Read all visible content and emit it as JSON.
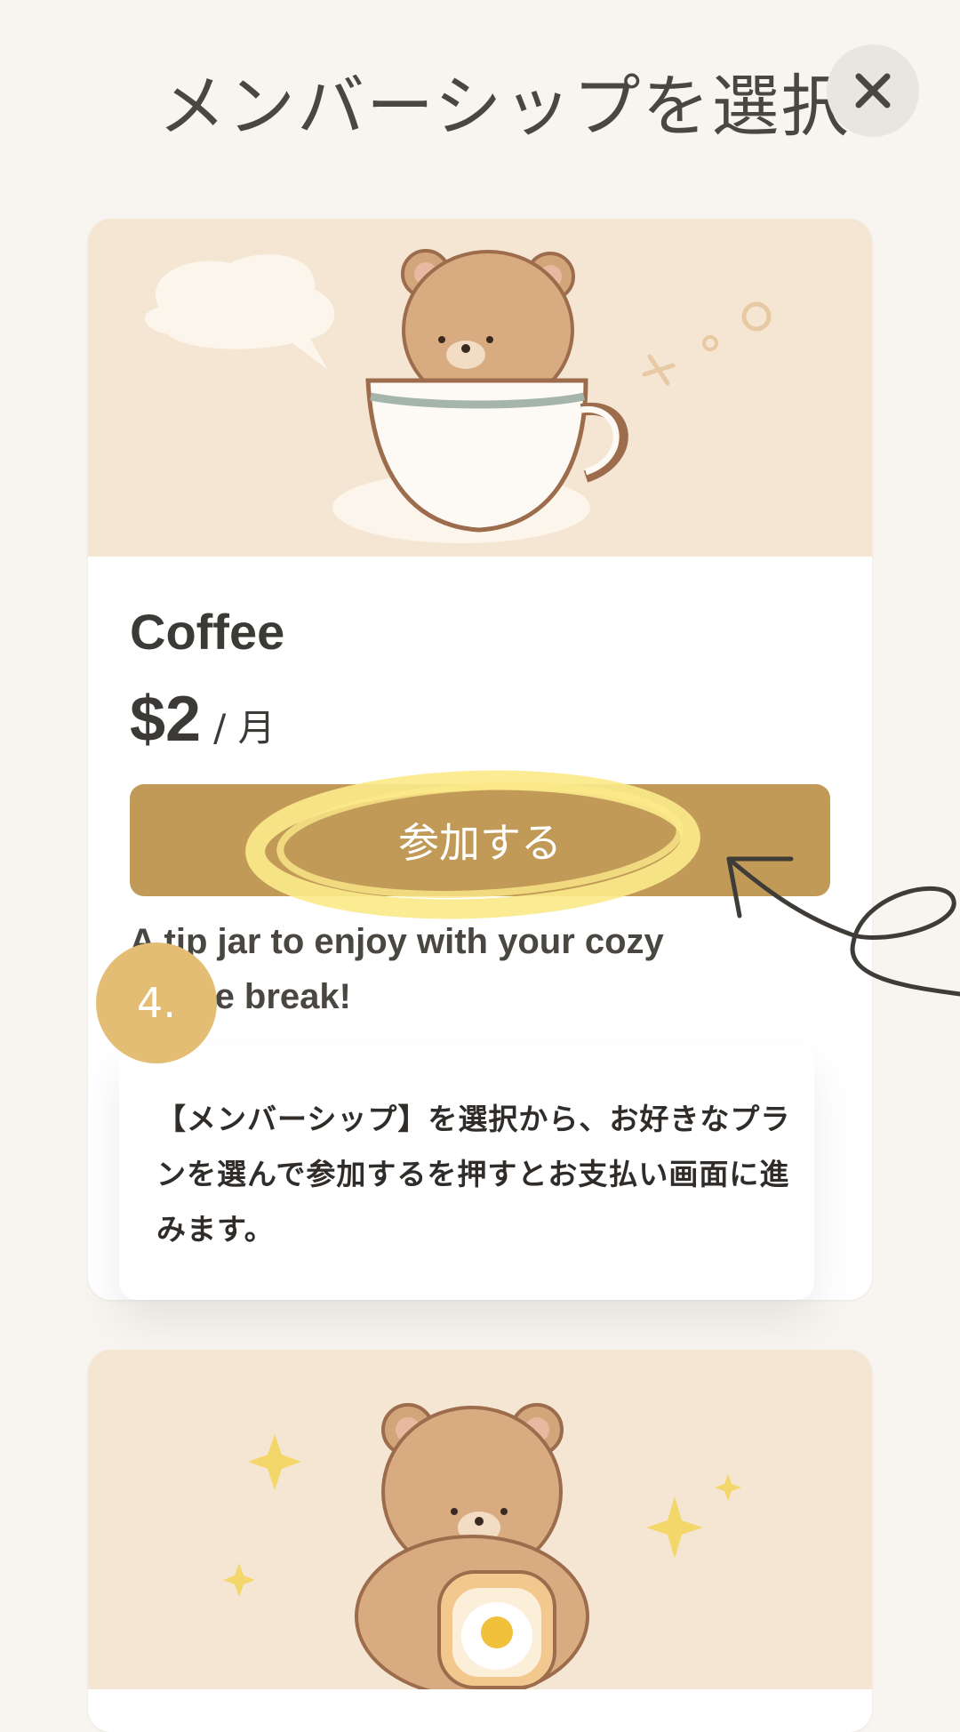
{
  "header": {
    "title": "メンバーシップを選択",
    "close_icon": "close-icon"
  },
  "tiers": [
    {
      "name": "Coffee",
      "price": "$2",
      "period": "/ 月",
      "join_label": "参加する",
      "description": "A tip jar to enjoy with your cozy coffee break!",
      "illustration": "bear-in-coffee-cup"
    },
    {
      "illustration": "bear-with-egg-toast"
    }
  ],
  "tutorial": {
    "step": "4.",
    "instruction": "【メンバーシップ】を選択から、お好きなプランを選んで参加するを押すとお支払い画面に進みます。"
  },
  "colors": {
    "accent": "#c19a58",
    "highlight": "#fbe98a",
    "banner": "#f4e6d2",
    "badge": "#e2bd73"
  }
}
